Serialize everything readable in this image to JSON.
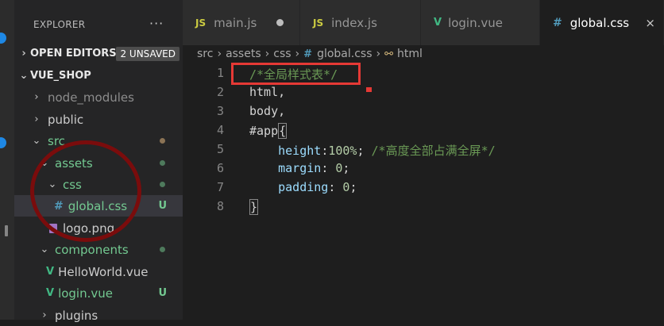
{
  "sidebar": {
    "title": "EXPLORER",
    "more": "···",
    "open_editors": {
      "label": "OPEN EDITORS",
      "badge": "2 UNSAVED"
    },
    "project": "VUE_SHOP",
    "tree": [
      {
        "label": "node_modules",
        "chevron": "›"
      },
      {
        "label": "public",
        "chevron": "›"
      },
      {
        "label": "src",
        "chevron": "⌄"
      },
      {
        "label": "assets",
        "chevron": "⌄"
      },
      {
        "label": "css",
        "chevron": "⌄"
      },
      {
        "label": "global.css",
        "status": "U"
      },
      {
        "label": "logo.png"
      },
      {
        "label": "components",
        "chevron": "⌄"
      },
      {
        "label": "HelloWorld.vue"
      },
      {
        "label": "login.vue",
        "status": "U"
      },
      {
        "label": "plugins",
        "chevron": "›"
      }
    ]
  },
  "tabs": [
    {
      "label": "main.js",
      "icon": "JS"
    },
    {
      "label": "index.js",
      "icon": "JS"
    },
    {
      "label": "login.vue",
      "icon": "V"
    },
    {
      "label": "global.css",
      "icon": "#",
      "close": "×"
    }
  ],
  "breadcrumb": [
    "src",
    "assets",
    "css",
    "global.css",
    "html"
  ],
  "code": {
    "line_numbers": [
      "1",
      "2",
      "3",
      "4",
      "5",
      "6",
      "7",
      "8"
    ],
    "l1": "/*全局样式表*/",
    "l2": "html,",
    "l3": "body,",
    "l4a": "#app",
    "l4b": "{",
    "l5_prop": "height",
    "l5_val": "100%",
    "l5_cmt": "/*高度全部占满全屏*/",
    "l6_prop": "margin",
    "l6_val": "0",
    "l7_prop": "padding",
    "l7_val": "0",
    "l8": "}"
  },
  "colors": {
    "accent_blue": "#1e88e5",
    "annotation_red": "#e53935",
    "annotation_dark_red": "#7a0c0c"
  }
}
